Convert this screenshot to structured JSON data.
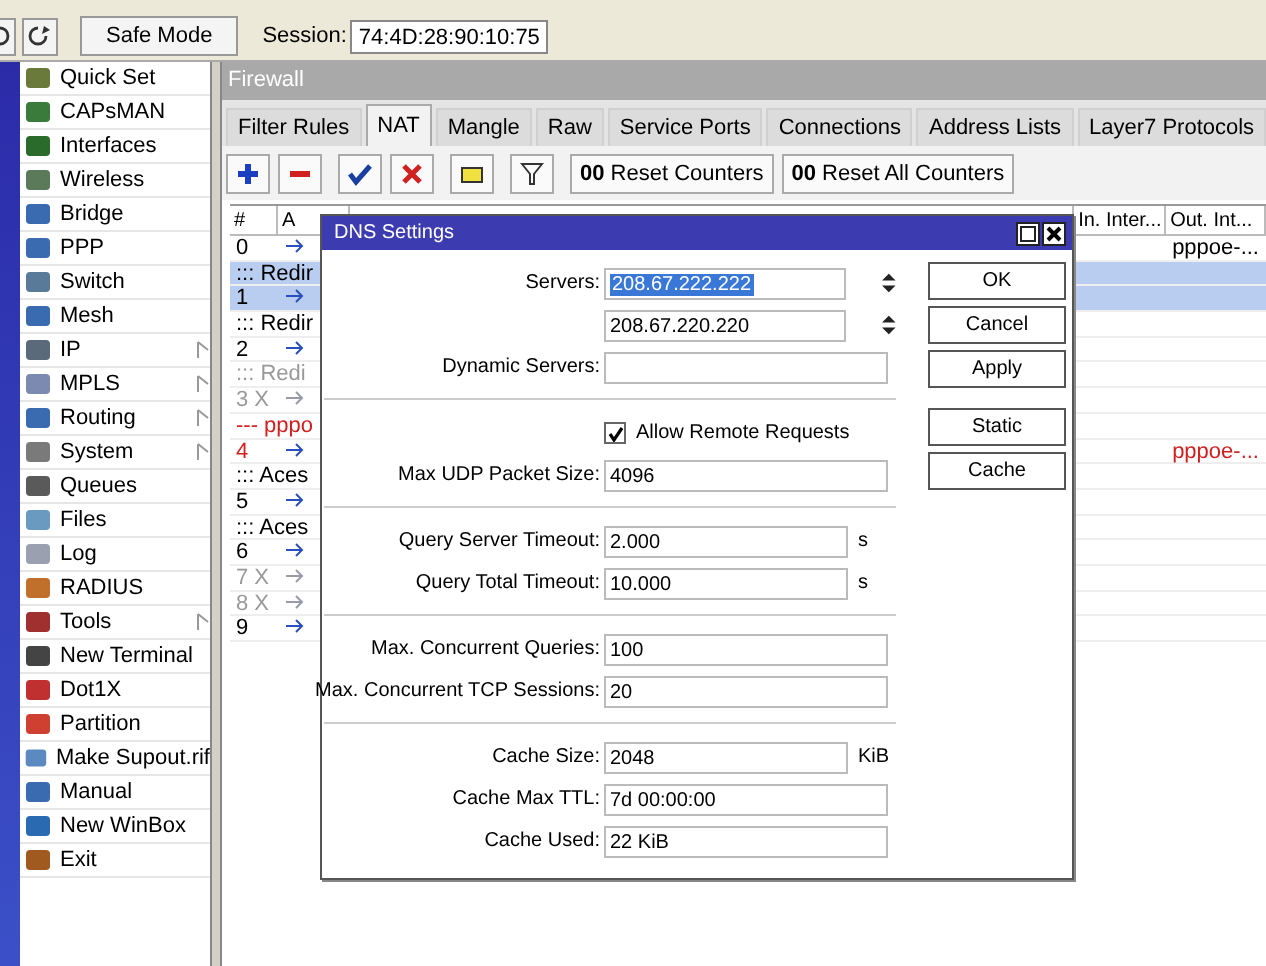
{
  "toolbar": {
    "safe_mode": "Safe Mode",
    "session_label": "Session:",
    "session": "74:4D:28:90:10:75"
  },
  "sidebar": {
    "items": [
      {
        "label": "Quick Set",
        "submenu": false
      },
      {
        "label": "CAPsMAN",
        "submenu": false
      },
      {
        "label": "Interfaces",
        "submenu": false
      },
      {
        "label": "Wireless",
        "submenu": false
      },
      {
        "label": "Bridge",
        "submenu": false
      },
      {
        "label": "PPP",
        "submenu": false
      },
      {
        "label": "Switch",
        "submenu": false
      },
      {
        "label": "Mesh",
        "submenu": false
      },
      {
        "label": "IP",
        "submenu": true
      },
      {
        "label": "MPLS",
        "submenu": true
      },
      {
        "label": "Routing",
        "submenu": true
      },
      {
        "label": "System",
        "submenu": true
      },
      {
        "label": "Queues",
        "submenu": false
      },
      {
        "label": "Files",
        "submenu": false
      },
      {
        "label": "Log",
        "submenu": false
      },
      {
        "label": "RADIUS",
        "submenu": false
      },
      {
        "label": "Tools",
        "submenu": true
      },
      {
        "label": "New Terminal",
        "submenu": false
      },
      {
        "label": "Dot1X",
        "submenu": false
      },
      {
        "label": "Partition",
        "submenu": false
      },
      {
        "label": "Make Supout.rif",
        "submenu": false
      },
      {
        "label": "Manual",
        "submenu": false
      },
      {
        "label": "New WinBox",
        "submenu": false
      },
      {
        "label": "Exit",
        "submenu": false
      }
    ]
  },
  "firewall": {
    "title": "Firewall",
    "tabs": [
      {
        "label": "Filter Rules",
        "selected": false
      },
      {
        "label": "NAT",
        "selected": true
      },
      {
        "label": "Mangle",
        "selected": false
      },
      {
        "label": "Raw",
        "selected": false
      },
      {
        "label": "Service Ports",
        "selected": false
      },
      {
        "label": "Connections",
        "selected": false
      },
      {
        "label": "Address Lists",
        "selected": false
      },
      {
        "label": "Layer7 Protocols",
        "selected": false
      }
    ],
    "counter_buttons": [
      "**00** Reset Counters",
      "**00** Reset All Counters"
    ],
    "table": {
      "columns": [
        "#",
        "A",
        "In. Inter...",
        "Out. Int..."
      ],
      "rows": [
        {
          "kind": "rule",
          "number": "0",
          "disabled": false,
          "invalid": false,
          "selected": false,
          "out": "pppoe-..."
        },
        {
          "kind": "comment",
          "text": "::: Redir",
          "disabled": false,
          "invalid": false,
          "selected": true
        },
        {
          "kind": "rule",
          "number": "1",
          "disabled": false,
          "invalid": false,
          "selected": true
        },
        {
          "kind": "comment",
          "text": "::: Redir",
          "disabled": false,
          "invalid": false,
          "selected": false
        },
        {
          "kind": "rule",
          "number": "2",
          "disabled": false,
          "invalid": false,
          "selected": false
        },
        {
          "kind": "comment",
          "text": "::: Redi",
          "disabled": true,
          "invalid": false,
          "selected": false
        },
        {
          "kind": "rule",
          "number": "3",
          "flag": "X",
          "disabled": true,
          "invalid": false,
          "selected": false
        },
        {
          "kind": "comment",
          "text": "--- pppo",
          "disabled": false,
          "invalid": true,
          "selected": false
        },
        {
          "kind": "rule",
          "number": "4",
          "disabled": false,
          "invalid": true,
          "selected": false,
          "out": "pppoe-..."
        },
        {
          "kind": "comment",
          "text": "::: Aces",
          "disabled": false,
          "invalid": false,
          "selected": false
        },
        {
          "kind": "rule",
          "number": "5",
          "disabled": false,
          "invalid": false,
          "selected": false
        },
        {
          "kind": "comment",
          "text": "::: Aces",
          "disabled": false,
          "invalid": false,
          "selected": false
        },
        {
          "kind": "rule",
          "number": "6",
          "disabled": false,
          "invalid": false,
          "selected": false
        },
        {
          "kind": "rule",
          "number": "7",
          "flag": "X",
          "disabled": true,
          "invalid": false,
          "selected": false
        },
        {
          "kind": "rule",
          "number": "8",
          "flag": "X",
          "disabled": true,
          "invalid": false,
          "selected": false
        },
        {
          "kind": "rule",
          "number": "9",
          "disabled": false,
          "invalid": false,
          "selected": false
        }
      ]
    }
  },
  "dns_dialog": {
    "title": "DNS Settings",
    "fields": [
      {
        "kind": "field",
        "label": "Servers:",
        "value": "208.67.222.222",
        "highlighted": true,
        "spinner": true
      },
      {
        "kind": "field",
        "value": "208.67.220.220",
        "highlighted": false,
        "spinner": true
      },
      {
        "kind": "field",
        "label": "Dynamic Servers:"
      },
      {
        "kind": "separator"
      },
      {
        "kind": "checkbox",
        "label": "Allow Remote Requests",
        "checked": true
      },
      {
        "kind": "field",
        "label": "Max UDP Packet Size:",
        "value": "4096",
        "highlighted": false
      },
      {
        "kind": "separator"
      },
      {
        "kind": "field",
        "label": "Query Server Timeout:",
        "value": "2.000",
        "unit": "s",
        "highlighted": false
      },
      {
        "kind": "field",
        "label": "Query Total Timeout:",
        "value": "10.000",
        "unit": "s",
        "highlighted": false
      },
      {
        "kind": "separator"
      },
      {
        "kind": "field",
        "label": "Max. Concurrent Queries:",
        "value": "100",
        "highlighted": false
      },
      {
        "kind": "field",
        "label": "Max. Concurrent TCP Sessions:",
        "value": "20",
        "highlighted": false
      },
      {
        "kind": "separator"
      },
      {
        "kind": "field",
        "label": "Cache Size:",
        "value": "2048",
        "unit": "KiB",
        "highlighted": false
      },
      {
        "kind": "field",
        "label": "Cache Max TTL:",
        "value": "7d 00:00:00",
        "highlighted": false
      },
      {
        "kind": "field",
        "label": "Cache Used:",
        "value": "22 KiB",
        "highlighted": false
      }
    ],
    "buttons": [
      "OK",
      "Cancel",
      "Apply"
    ],
    "extra_buttons": [
      "Static",
      "Cache"
    ]
  }
}
